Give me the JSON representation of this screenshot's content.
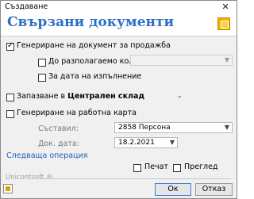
{
  "window": {
    "title": "Създаване",
    "close_glyph": "✕"
  },
  "header": {
    "title": "Свързани документи",
    "icon": "document-icon"
  },
  "options": {
    "gen_sales_doc": {
      "label": "Генериране на документ за продажба",
      "checked": true
    },
    "to_available_qty": {
      "label": "До разполагаемо кол. в:",
      "checked": false,
      "select_value": ""
    },
    "execution_date": {
      "label": "За дата на изпълнение",
      "checked": false
    },
    "save_in": {
      "label_prefix": "Запазване в",
      "label_bold": "Централен склад",
      "checked": false
    },
    "gen_work_card": {
      "label": "Генериране на работна карта",
      "checked": false
    }
  },
  "fields": {
    "author_label": "Съставил:",
    "author_value": "2858 Персона",
    "doc_date_label": "Док. дата:",
    "doc_date_value": "18.2.2021"
  },
  "next_operation": "Следваща операция",
  "print": {
    "label": "Печат",
    "checked": false
  },
  "preview": {
    "label": "Преглед",
    "checked": false
  },
  "brand": "Unicontsoft ®",
  "buttons": {
    "ok": "Ок",
    "cancel": "Отказ"
  }
}
